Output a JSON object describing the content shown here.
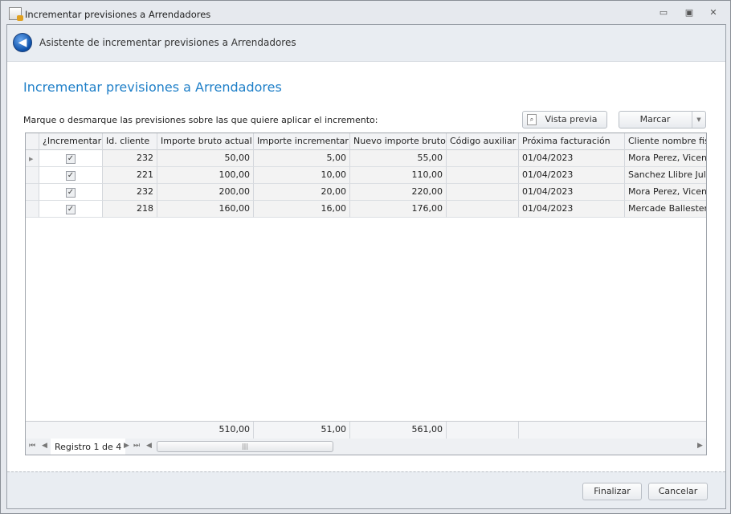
{
  "window": {
    "title": "Incrementar previsiones a Arrendadores",
    "minimize": "▭",
    "maximize": "▣",
    "close": "✕"
  },
  "header": {
    "title": "Asistente de incrementar previsiones a Arrendadores",
    "back_icon": "arrow-left"
  },
  "page": {
    "title": "Incrementar previsiones a Arrendadores",
    "instruction": "Marque o desmarque las previsiones sobre las que quiere aplicar el incremento:"
  },
  "toolbar": {
    "preview_label": "Vista previa",
    "mark_label": "Marcar"
  },
  "grid": {
    "columns": [
      "¿Incrementar?",
      "Id. cliente",
      "Importe bruto actual",
      "Importe incrementar",
      "Nuevo importe bruto",
      "Código auxiliar",
      "Próxima facturación",
      "Cliente nombre fiscal"
    ],
    "rows": [
      {
        "checked": true,
        "id": "232",
        "actual": "50,00",
        "inc": "5,00",
        "nuevo": "55,00",
        "aux": "",
        "fecha": "01/04/2023",
        "cliente": "Mora Perez, Vicente"
      },
      {
        "checked": true,
        "id": "221",
        "actual": "100,00",
        "inc": "10,00",
        "nuevo": "110,00",
        "aux": "",
        "fecha": "01/04/2023",
        "cliente": "Sanchez Llibre Julian"
      },
      {
        "checked": true,
        "id": "232",
        "actual": "200,00",
        "inc": "20,00",
        "nuevo": "220,00",
        "aux": "",
        "fecha": "01/04/2023",
        "cliente": "Mora Perez, Vicente"
      },
      {
        "checked": true,
        "id": "218",
        "actual": "160,00",
        "inc": "16,00",
        "nuevo": "176,00",
        "aux": "",
        "fecha": "01/04/2023",
        "cliente": "Mercade Ballesteros,"
      }
    ],
    "totals": {
      "actual": "510,00",
      "inc": "51,00",
      "nuevo": "561,00"
    },
    "navigator": "Registro 1 de 4"
  },
  "footer": {
    "finish_label": "Finalizar",
    "cancel_label": "Cancelar"
  }
}
